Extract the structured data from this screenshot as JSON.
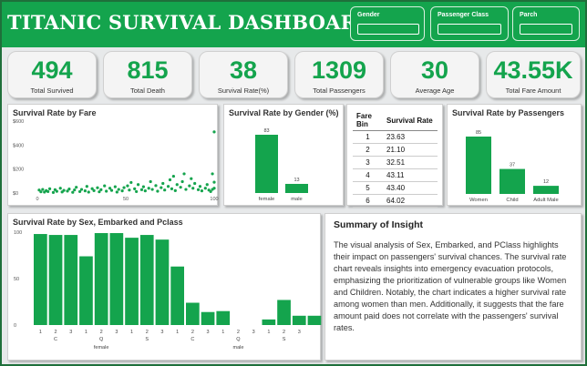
{
  "header": {
    "title": "TITANIC SURVIVAL DASHBOARD",
    "slicers": [
      {
        "label": "Gender",
        "value": ""
      },
      {
        "label": "Passenger Class",
        "value": ""
      },
      {
        "label": "Parch",
        "value": ""
      }
    ]
  },
  "kpis": [
    {
      "value": "494",
      "label": "Total Survived"
    },
    {
      "value": "815",
      "label": "Total Death"
    },
    {
      "value": "38",
      "label": "Survival Rate(%)"
    },
    {
      "value": "1309",
      "label": "Total Passengers"
    },
    {
      "value": "30",
      "label": "Average Age"
    },
    {
      "value": "43.55K",
      "label": "Total Fare Amount"
    }
  ],
  "colors": {
    "accent": "#14a44d",
    "background": "#e7e9ea",
    "card": "#ffffff"
  },
  "fare_table": {
    "headers": [
      "Fare Bin",
      "Survival Rate"
    ],
    "rows": [
      [
        "1",
        "23.63"
      ],
      [
        "2",
        "21.10"
      ],
      [
        "3",
        "32.51"
      ],
      [
        "4",
        "43.11"
      ],
      [
        "5",
        "43.40"
      ],
      [
        "6",
        "64.02"
      ]
    ]
  },
  "insight": {
    "title": "Summary of Insight",
    "text": "The visual analysis of Sex, Embarked, and PClass highlights their impact on passengers' survival chances. The survival rate chart reveals insights into emergency evacuation protocols, emphasizing the prioritization of vulnerable groups like Women and Children. Notably, the chart indicates a higher survival rate among women than men. Additionally, it suggests that the fare amount paid does not correlate with the passengers' survival rates."
  },
  "chart_data": [
    {
      "type": "scatter",
      "title": "Survival Rate by Fare",
      "x_ticks": [
        "0",
        "50",
        "100"
      ],
      "y_ticks": [
        "$0",
        "$200",
        "$400",
        "$600"
      ],
      "xlim": [
        0,
        100
      ],
      "ylim": [
        0,
        600
      ],
      "points": [
        [
          1,
          25
        ],
        [
          2,
          10
        ],
        [
          3,
          30
        ],
        [
          4,
          8
        ],
        [
          5,
          20
        ],
        [
          6,
          12
        ],
        [
          7,
          35
        ],
        [
          9,
          5
        ],
        [
          10,
          28
        ],
        [
          11,
          14
        ],
        [
          13,
          40
        ],
        [
          14,
          9
        ],
        [
          15,
          22
        ],
        [
          17,
          16
        ],
        [
          18,
          33
        ],
        [
          20,
          6
        ],
        [
          21,
          26
        ],
        [
          22,
          48
        ],
        [
          24,
          12
        ],
        [
          25,
          30
        ],
        [
          27,
          18
        ],
        [
          28,
          55
        ],
        [
          29,
          8
        ],
        [
          31,
          36
        ],
        [
          32,
          20
        ],
        [
          34,
          44
        ],
        [
          35,
          10
        ],
        [
          36,
          28
        ],
        [
          38,
          60
        ],
        [
          39,
          15
        ],
        [
          41,
          40
        ],
        [
          42,
          22
        ],
        [
          44,
          52
        ],
        [
          45,
          8
        ],
        [
          46,
          30
        ],
        [
          48,
          18
        ],
        [
          49,
          45
        ],
        [
          51,
          60
        ],
        [
          52,
          25
        ],
        [
          53,
          88
        ],
        [
          55,
          35
        ],
        [
          56,
          12
        ],
        [
          57,
          70
        ],
        [
          59,
          28
        ],
        [
          60,
          52
        ],
        [
          61,
          18
        ],
        [
          63,
          40
        ],
        [
          64,
          95
        ],
        [
          65,
          30
        ],
        [
          67,
          62
        ],
        [
          68,
          15
        ],
        [
          70,
          45
        ],
        [
          71,
          80
        ],
        [
          72,
          25
        ],
        [
          74,
          55
        ],
        [
          75,
          110
        ],
        [
          76,
          35
        ],
        [
          77,
          140
        ],
        [
          78,
          20
        ],
        [
          79,
          70
        ],
        [
          81,
          48
        ],
        [
          82,
          95
        ],
        [
          83,
          160
        ],
        [
          84,
          30
        ],
        [
          86,
          60
        ],
        [
          87,
          120
        ],
        [
          88,
          40
        ],
        [
          89,
          80
        ],
        [
          91,
          28
        ],
        [
          92,
          55
        ],
        [
          93,
          18
        ],
        [
          95,
          40
        ],
        [
          96,
          70
        ],
        [
          97,
          25
        ],
        [
          98,
          12
        ],
        [
          99,
          160
        ],
        [
          99,
          30
        ],
        [
          100,
          90
        ],
        [
          100,
          40
        ],
        [
          100,
          510
        ]
      ]
    },
    {
      "type": "bar",
      "title": "Survival Rate by Gender (%)",
      "categories": [
        "female",
        "male"
      ],
      "values": [
        83,
        13
      ],
      "data_labels": [
        "83",
        "13"
      ]
    },
    {
      "type": "bar",
      "title": "Survival Rate by Passengers",
      "categories": [
        "Women",
        "Child",
        "Adult Male"
      ],
      "values": [
        85,
        37,
        12
      ],
      "data_labels": [
        "85",
        "37",
        "12"
      ]
    },
    {
      "type": "bar",
      "title": "Survival Rate by Sex, Embarked and Pclass",
      "y_ticks": [
        "0",
        "50",
        "100"
      ],
      "ylim": [
        0,
        100
      ],
      "pclass_labels": [
        "1",
        "2",
        "3",
        "1",
        "2",
        "3",
        "1",
        "2",
        "3",
        "1",
        "2",
        "3",
        "1",
        "2",
        "3",
        "1",
        "2",
        "3"
      ],
      "embarked_labels": [
        "C",
        "Q",
        "S",
        "C",
        "Q",
        "S"
      ],
      "sex_labels": [
        "female",
        "male"
      ],
      "values": [
        98,
        97,
        97,
        74,
        99,
        99,
        94,
        97,
        92,
        63,
        24,
        14,
        15,
        0,
        0,
        6,
        27,
        10,
        10
      ]
    }
  ]
}
